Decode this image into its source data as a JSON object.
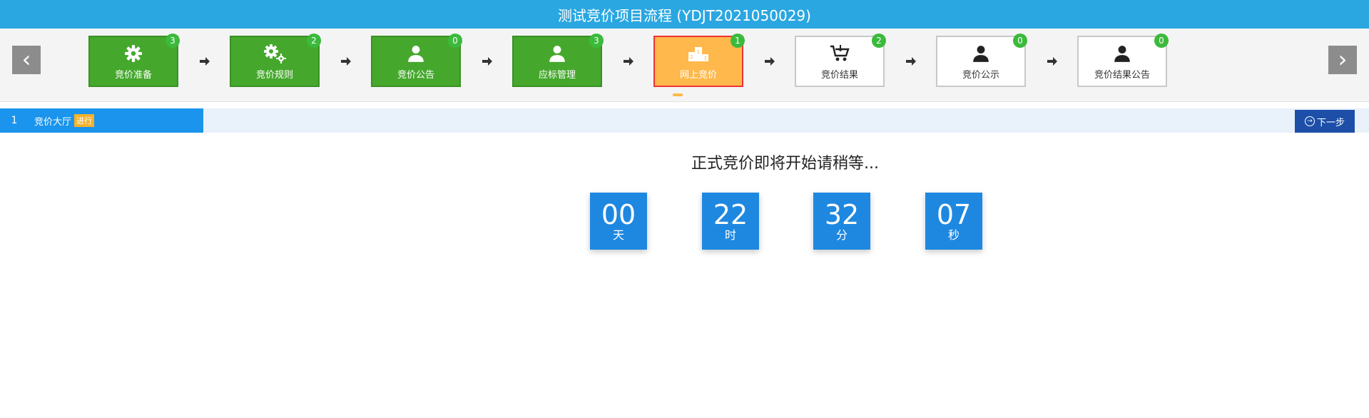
{
  "title": "测试竞价项目流程 (YDJT2021050029)",
  "nav": {
    "prev_icon": "‹",
    "next_icon": "›"
  },
  "steps": [
    {
      "label": "竞价准备",
      "badge": "3",
      "state": "done",
      "icon": "gear-icon"
    },
    {
      "label": "竞价规则",
      "badge": "2",
      "state": "done",
      "icon": "gears-icon"
    },
    {
      "label": "竞价公告",
      "badge": "0",
      "state": "done",
      "icon": "user-icon"
    },
    {
      "label": "应标管理",
      "badge": "3",
      "state": "done",
      "icon": "user-icon"
    },
    {
      "label": "网上竞价",
      "badge": "1",
      "state": "active",
      "icon": "podium-icon"
    },
    {
      "label": "竞价结果",
      "badge": "2",
      "state": "todo",
      "icon": "cart-icon"
    },
    {
      "label": "竞价公示",
      "badge": "0",
      "state": "todo",
      "icon": "user-icon"
    },
    {
      "label": "竞价结果公告",
      "badge": "0",
      "state": "todo",
      "icon": "user-icon"
    }
  ],
  "stage": {
    "number": "1",
    "label": "竞价大厅",
    "status": "进行",
    "next_label": "下一步"
  },
  "message": "正式竞价即将开始请稍等...",
  "countdown": [
    {
      "value": "00",
      "unit": "天"
    },
    {
      "value": "22",
      "unit": "时"
    },
    {
      "value": "32",
      "unit": "分"
    },
    {
      "value": "07",
      "unit": "秒"
    }
  ],
  "colors": {
    "header": "#2aa7e1",
    "step_done": "#45a82d",
    "step_active": "#ffb84b",
    "badge": "#3bba3b",
    "countdown": "#1e88e1",
    "next_button": "#1d4fa8"
  }
}
